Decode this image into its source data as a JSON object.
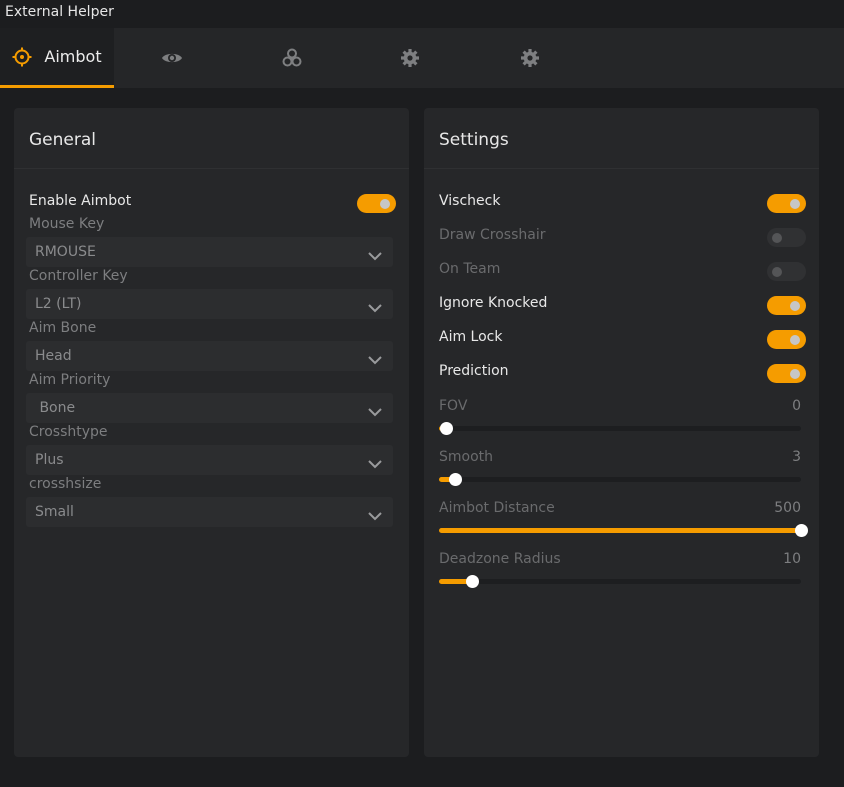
{
  "window": {
    "title": "External Helper"
  },
  "tabs": [
    {
      "label": "Aimbot",
      "icon": "crosshair-icon",
      "active": true
    },
    {
      "label": "",
      "icon": "eye-icon",
      "active": false
    },
    {
      "label": "",
      "icon": "biohazard-icon",
      "active": false
    },
    {
      "label": "",
      "icon": "gear-icon",
      "active": false
    },
    {
      "label": "",
      "icon": "gear-icon",
      "active": false
    }
  ],
  "colors": {
    "accent": "#f59c00",
    "background": "#1c1d1f",
    "panel": "#262729"
  },
  "general": {
    "title": "General",
    "enable_aimbot": {
      "label": "Enable Aimbot",
      "on": true
    },
    "mouse_key": {
      "label": "Mouse Key",
      "value": "RMOUSE"
    },
    "controller_key": {
      "label": "Controller Key",
      "value": "L2 (LT)"
    },
    "aim_bone": {
      "label": "Aim Bone",
      "value": "Head"
    },
    "aim_priority": {
      "label": "Aim Priority",
      "value": " Bone"
    },
    "crosshtype": {
      "label": "Crosshtype",
      "value": "Plus"
    },
    "crosshsize": {
      "label": "crosshsize",
      "value": "Small"
    }
  },
  "settings": {
    "title": "Settings",
    "vischeck": {
      "label": "Vischeck",
      "on": true
    },
    "draw_crosshair": {
      "label": "Draw Crosshair",
      "on": false
    },
    "on_team": {
      "label": "On Team",
      "on": false
    },
    "ignore_knocked": {
      "label": "Ignore Knocked",
      "on": true
    },
    "aim_lock": {
      "label": "Aim Lock",
      "on": true
    },
    "prediction": {
      "label": "Prediction",
      "on": true
    },
    "fov": {
      "label": "FOV",
      "value": "0",
      "level": 0.02
    },
    "smooth": {
      "label": "Smooth",
      "value": "3",
      "level": 0.045
    },
    "aimbot_distance": {
      "label": "Aimbot Distance",
      "value": "500",
      "level": 1.0
    },
    "deadzone_radius": {
      "label": "Deadzone Radius",
      "value": "10",
      "level": 0.09
    }
  }
}
